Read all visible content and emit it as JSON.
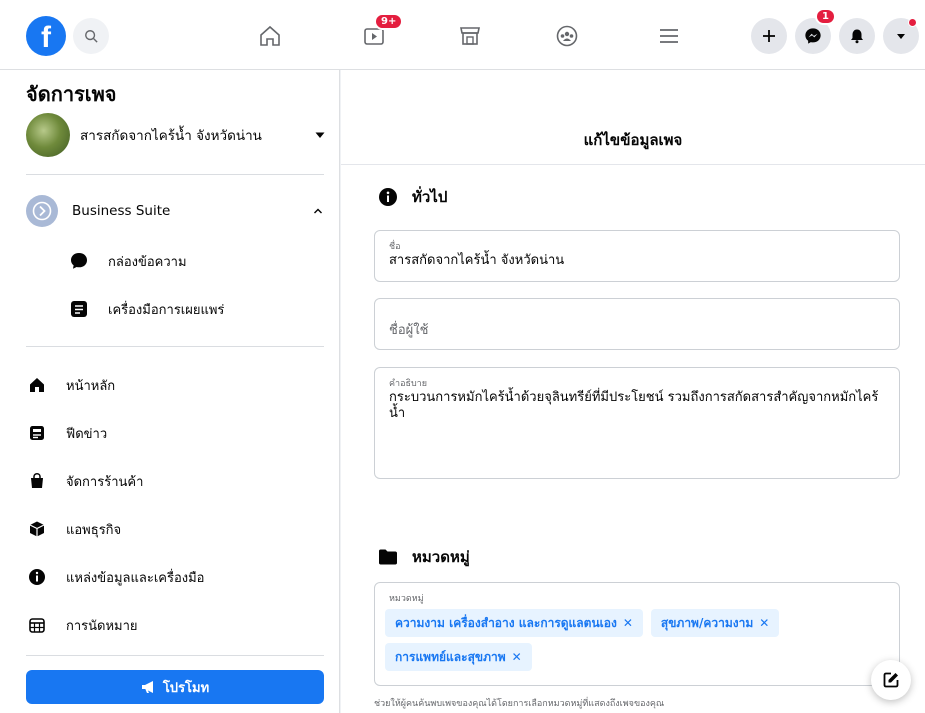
{
  "topbar": {
    "logo_letter": "f",
    "watch_badge": "9+",
    "messenger_badge": "1"
  },
  "sidebar": {
    "title": "จัดการเพจ",
    "page_name": "สารสกัดจากไคร้น้ำ จังหวัดน่าน",
    "business_suite": "Business Suite",
    "sub_items": [
      {
        "label": "กล่องข้อความ",
        "icon": "message-bubble-icon"
      },
      {
        "label": "เครื่องมือการเผยแพร่",
        "icon": "publishing-tools-icon"
      }
    ],
    "items": [
      {
        "label": "หน้าหลัก",
        "icon": "home-icon"
      },
      {
        "label": "ฟีดข่าว",
        "icon": "news-feed-icon"
      },
      {
        "label": "จัดการร้านค้า",
        "icon": "shop-bag-icon"
      },
      {
        "label": "แอพธุรกิจ",
        "icon": "cube-icon"
      },
      {
        "label": "แหล่งข้อมูลและเครื่องมือ",
        "icon": "info-icon"
      },
      {
        "label": "การนัดหมาย",
        "icon": "calendar-icon"
      }
    ],
    "promote_label": "โปรโมท"
  },
  "main": {
    "title": "แก้ไขข้อมูลเพจ",
    "general_heading": "ทั่วไป",
    "name_field": {
      "label": "ชื่อ",
      "value": "สารสกัดจากไคร้น้ำ จังหวัดน่าน"
    },
    "username_field": {
      "placeholder": "ชื่อผู้ใช้"
    },
    "description_field": {
      "label": "คำอธิบาย",
      "value": "กระบวนการหมักไคร้น้ำด้วยจุลินทรีย์ที่มีประโยชน์ รวมถึงการสกัดสารสำคัญจากหมักไคร้น้ำ"
    },
    "category_heading": "หมวดหมู่",
    "category_field": {
      "label": "หมวดหมู่",
      "chips": [
        "ความงาม เครื่องสำอาง และการดูแลตนเอง",
        "สุขภาพ/ความงาม",
        "การแพทย์และสุขภาพ"
      ],
      "remove_symbol": "✕"
    },
    "helper_text": "ช่วยให้ผู้คนค้นพบเพจของคุณได้โดยการเลือกหมวดหมู่ที่แสดงถึงเพจของคุณ"
  },
  "colors": {
    "brand": "#1877f2",
    "badge": "#e41e3f",
    "chip_bg": "#e7f3ff"
  }
}
